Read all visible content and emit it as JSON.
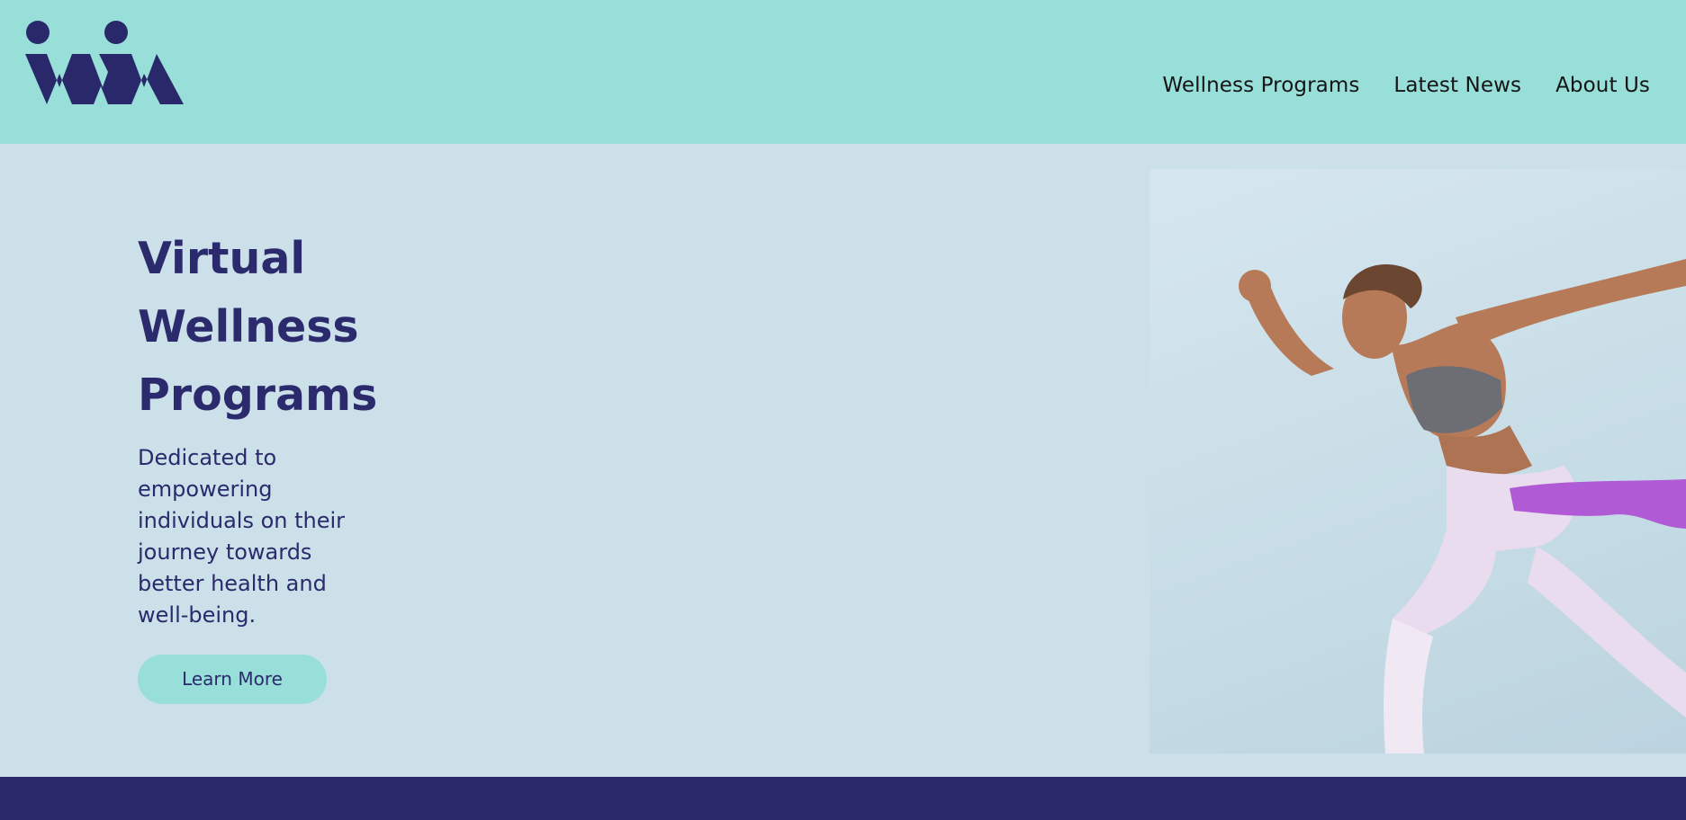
{
  "brand": {
    "logo_icon": "two-person-wellness-logo-icon",
    "primary_color": "#2a2a6c",
    "accent_color": "#97dfd8",
    "background_color": "#cbe0e8"
  },
  "nav": {
    "items": [
      {
        "label": "Wellness Programs"
      },
      {
        "label": "Latest News"
      },
      {
        "label": "About Us"
      }
    ]
  },
  "hero": {
    "title_lines": [
      "Virtual",
      "Wellness",
      "Programs"
    ],
    "description": "Dedicated to empowering individuals on their journey towards better health and well-being.",
    "cta_label": "Learn More",
    "image_subject": "woman-sprinting-with-resistance-band-image"
  },
  "footer": {
    "color": "#28286a"
  }
}
